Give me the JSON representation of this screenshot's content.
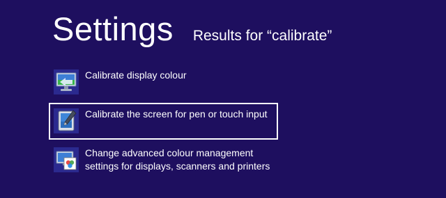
{
  "header": {
    "title": "Settings",
    "results_label": "Results for “calibrate”"
  },
  "results": [
    {
      "label_lines": [
        "Calibrate display colour"
      ],
      "icon": "monitor-calibrate-icon",
      "selected": false
    },
    {
      "label_lines": [
        "Calibrate the screen for pen or touch input"
      ],
      "icon": "tablet-pen-icon",
      "selected": true
    },
    {
      "label_lines": [
        "Change advanced colour management",
        "settings for displays, scanners and printers"
      ],
      "icon": "colour-management-icon",
      "selected": false
    }
  ],
  "colors": {
    "background": "#1e0f5f",
    "text": "#ffffff",
    "selection_outline": "#ffffff",
    "icon_tile": "#2b2a8f"
  }
}
